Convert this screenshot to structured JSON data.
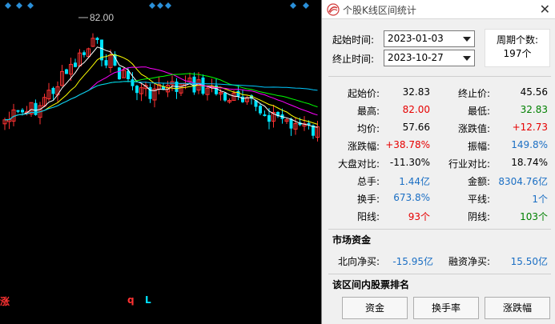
{
  "chart": {
    "price_label": "82.00",
    "bottom_labels": {
      "rise": "涨",
      "q": "q",
      "l": "L"
    },
    "colors": {
      "up": "#ff3232",
      "down": "#00e4ff",
      "ma5": "#ffffff",
      "ma10": "#ffff00",
      "ma20": "#ff00ff",
      "ma30": "#00ff00",
      "ma60": "#00c8ff"
    }
  },
  "panel": {
    "title": "个股K线区间统计",
    "close_glyph": "✕",
    "start_time_label": "起始时间:",
    "start_date": "2023-01-03",
    "end_time_label": "终止时间:",
    "end_date": "2023-10-27",
    "cycle_label": "周期个数:",
    "cycle_value": "197个",
    "stats": [
      {
        "label": "起始价:",
        "value": "32.83",
        "color": "#000000"
      },
      {
        "label": "终止价:",
        "value": "45.56",
        "color": "#000000"
      },
      {
        "label": "最高:",
        "value": "82.00",
        "color": "#e60000"
      },
      {
        "label": "最低:",
        "value": "32.83",
        "color": "#008000"
      },
      {
        "label": "均价:",
        "value": "57.66",
        "color": "#000000"
      },
      {
        "label": "涨跌值:",
        "value": "+12.73",
        "color": "#e60000"
      },
      {
        "label": "涨跌幅:",
        "value": "+38.78%",
        "color": "#e60000"
      },
      {
        "label": "振幅:",
        "value": "149.8%",
        "color": "#1b6fc4"
      },
      {
        "label": "大盘对比:",
        "value": "-11.30%",
        "color": "#000000"
      },
      {
        "label": "行业对比:",
        "value": "18.74%",
        "color": "#000000"
      },
      {
        "label": "总手:",
        "value": "1.44亿",
        "color": "#1b6fc4"
      },
      {
        "label": "金额:",
        "value": "8304.76亿",
        "color": "#1b6fc4"
      },
      {
        "label": "换手:",
        "value": "673.8%",
        "color": "#1b6fc4"
      },
      {
        "label": "平线:",
        "value": "1个",
        "color": "#1b6fc4"
      },
      {
        "label": "阳线:",
        "value": "93个",
        "color": "#e60000"
      },
      {
        "label": "阴线:",
        "value": "103个",
        "color": "#008000"
      }
    ],
    "market_funds_title": "市场资金",
    "north_label": "北向净买:",
    "north_value": "-15.95亿",
    "margin_label": "融资净买:",
    "margin_value": "15.50亿",
    "ranking_title": "该区间内股票排名",
    "buttons": [
      "资金",
      "换手率",
      "涨跌幅"
    ]
  }
}
